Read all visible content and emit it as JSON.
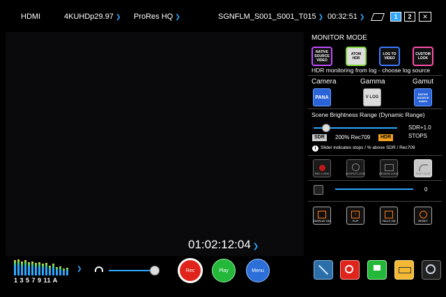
{
  "topbar": {
    "input": "HDMI",
    "resolution": "4KUHDp29.97",
    "codec": "ProRes HQ",
    "filename": "SGNFLM_S001_S001_T015",
    "time": "00:32:51",
    "slot1": "1",
    "slot2": "2",
    "close": "✕"
  },
  "monitor_mode": {
    "title": "MONITOR MODE",
    "modes": [
      {
        "label": "NATIVE SOURCE VIDEO",
        "color": "#c04cff"
      },
      {
        "label": "ATOM HDR",
        "color": "#7dd63b"
      },
      {
        "label": "LOG TO VIDEO",
        "color": "#3b7bff"
      },
      {
        "label": "CUSTOM LOOK",
        "color": "#ff4fa8"
      }
    ],
    "hint": "HDR monitoring from log - choose log source"
  },
  "source": {
    "camera_label": "Camera",
    "gamma_label": "Gamma",
    "gamut_label": "Gamut",
    "camera_value": "PANA",
    "gamma_value": "V LOG",
    "gamut_value": "NATIVE SOURCE VIDEO"
  },
  "brightness": {
    "title": "Scene Brightness Range (Dynamic Range)",
    "stops_value": "SDR+1.0",
    "stops_unit": "STOPS",
    "sdr_badge": "SDR",
    "rec_text": "200% Rec709",
    "hdr_badge": "HDR",
    "note": "Slider indicates stops / % above SDR / Rec709",
    "slider_fraction": 0.15
  },
  "look_buttons": [
    {
      "label": "REC LOOK"
    },
    {
      "label": "OUTPUT LOOK"
    },
    {
      "label": "REVIEW LOOK"
    },
    {
      "label": "SOFT CLIP"
    }
  ],
  "lut_slider": {
    "value": "0",
    "fraction": 0.0
  },
  "option_buttons": [
    {
      "label": "DISPLAY ON"
    },
    {
      "label": "FLIP"
    },
    {
      "label": "TALLY ON"
    },
    {
      "label": "RESET"
    }
  ],
  "timecode": "01:02:12:04",
  "audio": {
    "channels": "1 3 5 7 9 11 A",
    "volume_fraction": 0.85
  },
  "transport": {
    "rec": "Rec",
    "play": "Play",
    "menu": "Menu"
  },
  "colors": {
    "accent": "#2ea7ff",
    "orange": "#ff7a1a",
    "rec_red": "#e0241b",
    "play_green": "#23b83a",
    "menu_blue": "#2c6fd9"
  }
}
